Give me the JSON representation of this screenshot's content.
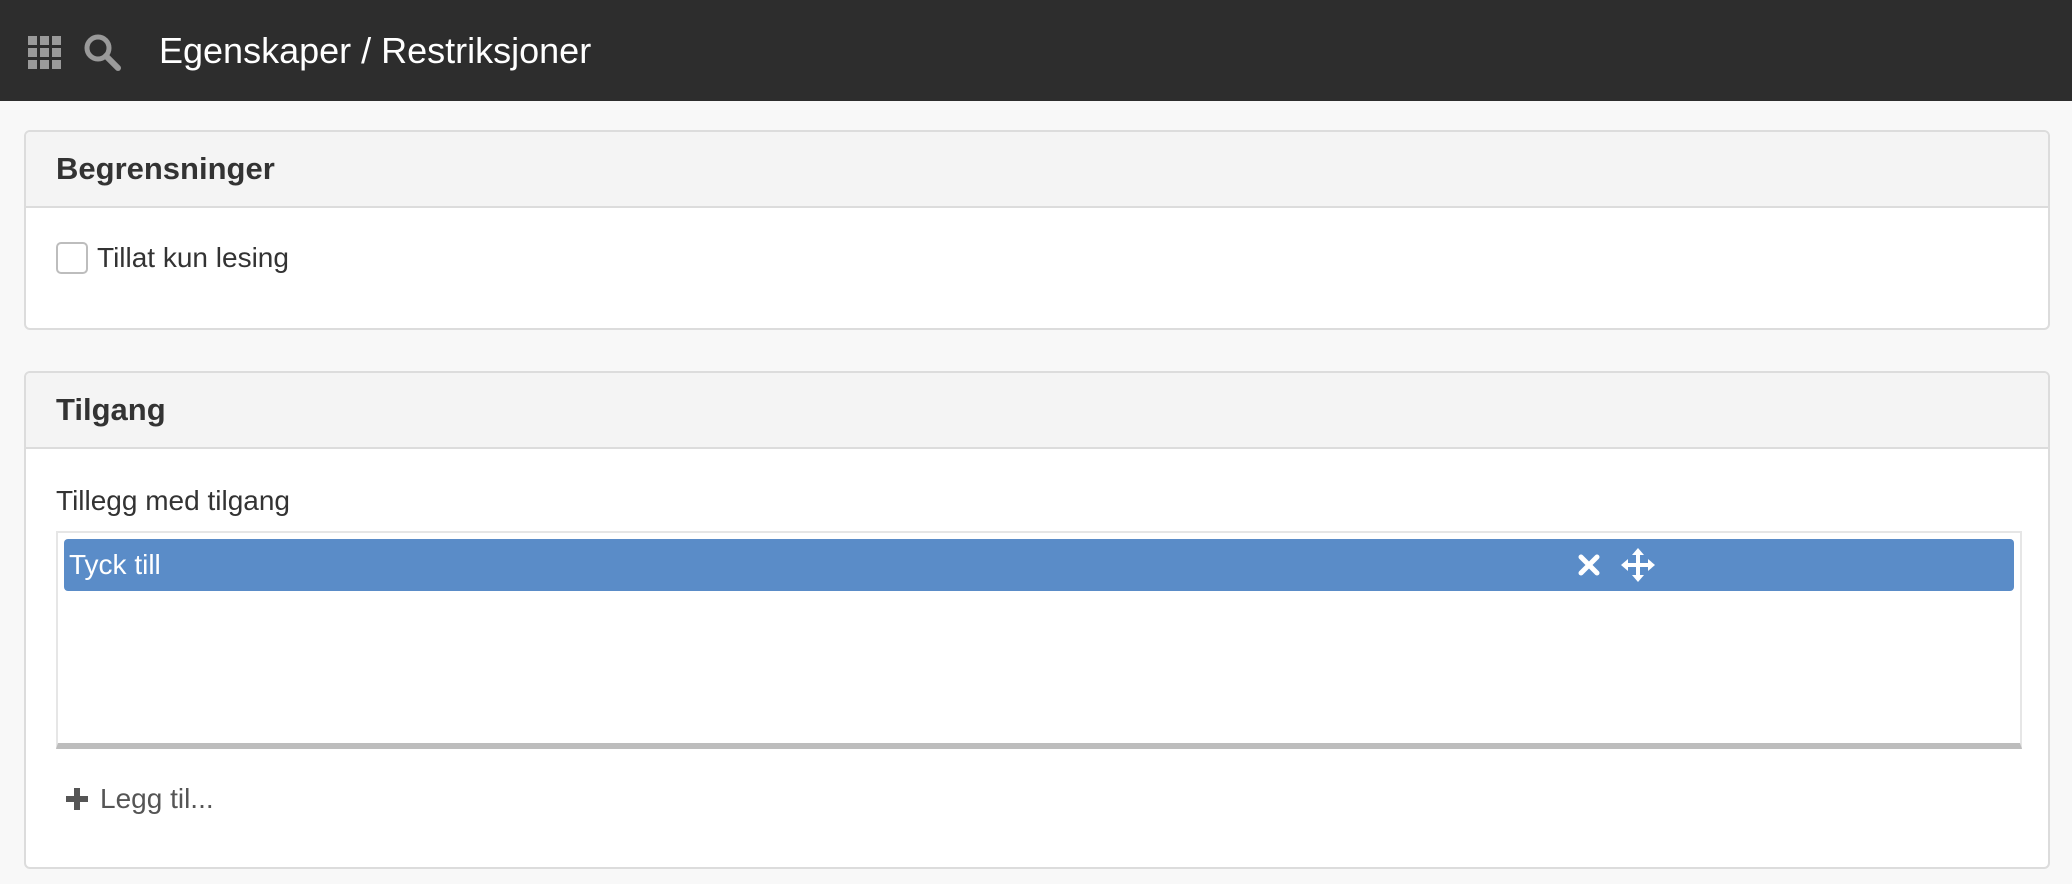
{
  "header": {
    "title": "Egenskaper / Restriksjoner",
    "apps_icon": "grid-icon",
    "search_icon": "search-icon",
    "background": "#2d2d2d"
  },
  "restrictions": {
    "title": "Begrensninger",
    "read_only": {
      "label": "Tillat kun lesing",
      "checked": false
    }
  },
  "access": {
    "title": "Tilgang",
    "list_label": "Tillegg med tilgang",
    "items": [
      {
        "label": "Tyck till"
      }
    ],
    "item_color": "#5a8cc8",
    "add_label": "Legg til..."
  }
}
